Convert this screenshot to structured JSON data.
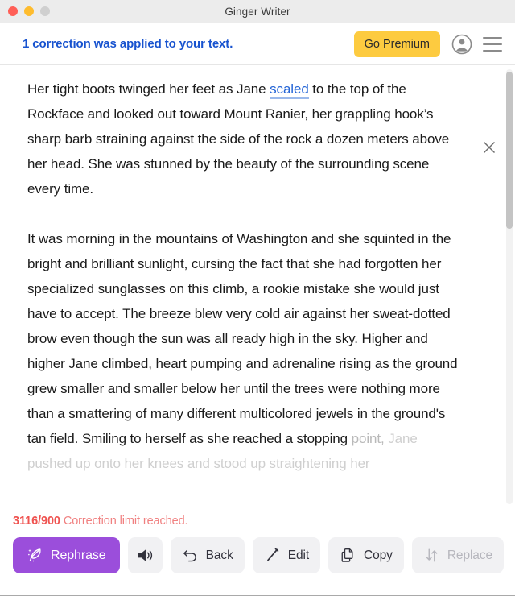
{
  "window": {
    "title": "Ginger Writer",
    "traffic_lights": [
      "close",
      "minimize",
      "zoom"
    ]
  },
  "header": {
    "banner_text": "1 correction was applied to your text.",
    "go_premium_label": "Go Premium",
    "avatar_icon": "user-circle-icon",
    "menu_icon": "hamburger-menu-icon"
  },
  "document": {
    "close_icon": "close-x-icon",
    "paragraph1": {
      "before": "Her tight boots twinged her feet as Jane ",
      "correction": "scaled",
      "after": " to the top of the Rockface and looked out toward Mount Ranier, her grappling hook’s sharp barb straining against the side of the rock a dozen meters above her head. She was stunned by the beauty of the surrounding scene every time."
    },
    "paragraph2": {
      "main": "It was morning in the mountains of Washington and she squinted in the bright and brilliant sunlight, cursing the fact that she had forgotten her specialized sunglasses on this climb, a rookie mistake she would just have to accept. The breeze blew very cold air against her sweat-dotted brow even though the sun was all ready high in the sky. Higher and higher Jane climbed, heart pumping and adrenaline rising as the ground grew smaller and smaller below her until the trees were nothing more than a smattering of many different multicolored jewels in the ground's tan field. Smiling to herself as she reached a stopping ",
      "faded_1": "point,",
      "faded_2": " Jane pushed up onto her knees and stood up straightening her"
    }
  },
  "footer": {
    "limit_count": "3116/900",
    "limit_message": "Correction limit reached.",
    "buttons": [
      {
        "id": "rephrase",
        "label": "Rephrase",
        "icon": "quill-sparkle-icon",
        "style": "primary",
        "disabled": false
      },
      {
        "id": "speak",
        "label": "",
        "icon": "speaker-icon",
        "style": "icon-only",
        "disabled": false
      },
      {
        "id": "back",
        "label": "Back",
        "icon": "undo-arrow-icon",
        "style": "default",
        "disabled": false
      },
      {
        "id": "edit",
        "label": "Edit",
        "icon": "pencil-icon",
        "style": "default",
        "disabled": false
      },
      {
        "id": "copy",
        "label": "Copy",
        "icon": "copy-pages-icon",
        "style": "default",
        "disabled": false
      },
      {
        "id": "replace",
        "label": "Replace",
        "icon": "swap-arrows-icon",
        "style": "disabled",
        "disabled": true
      }
    ]
  },
  "colors": {
    "accent_purple": "#9b4edb",
    "premium_yellow": "#fdcb40",
    "banner_blue": "#1853cf",
    "correction_blue": "#2565d6",
    "limit_red": "#ef5350"
  }
}
